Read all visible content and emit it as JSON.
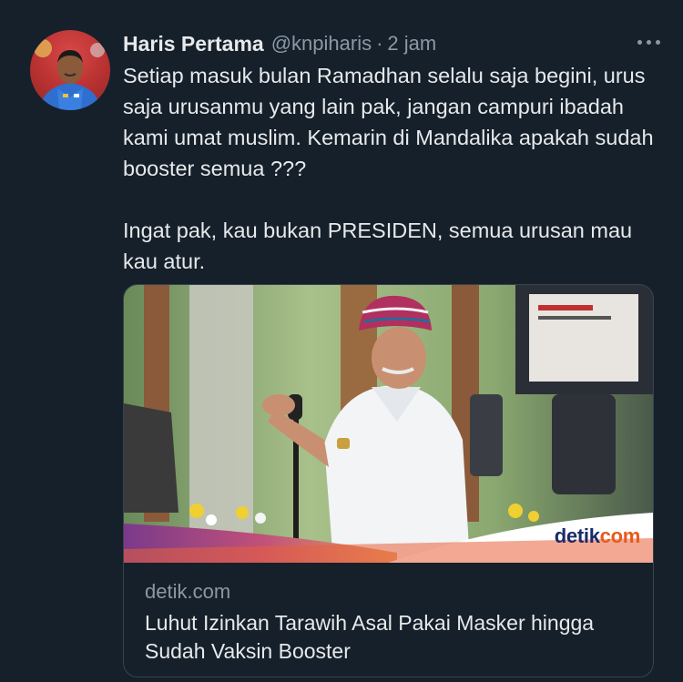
{
  "tweet": {
    "author_name": "Haris Pertama",
    "author_handle": "@knpiharis",
    "separator": "·",
    "timestamp": "2 jam",
    "paragraphs": [
      "Setiap masuk bulan Ramadhan selalu saja begini, urus saja urusanmu yang lain pak, jangan campuri ibadah kami umat muslim. Kemarin di Mandalika apakah sudah booster semua ???",
      "Ingat pak, kau bukan PRESIDEN, semua urusan mau kau atur."
    ]
  },
  "card": {
    "domain": "detik.com",
    "title": "Luhut Izinkan Tarawih Asal Pakai Masker hingga Sudah Vaksin Booster",
    "brand_part1": "detik",
    "brand_part2": "com"
  },
  "icons": {
    "more": "more-horizontal-icon"
  }
}
